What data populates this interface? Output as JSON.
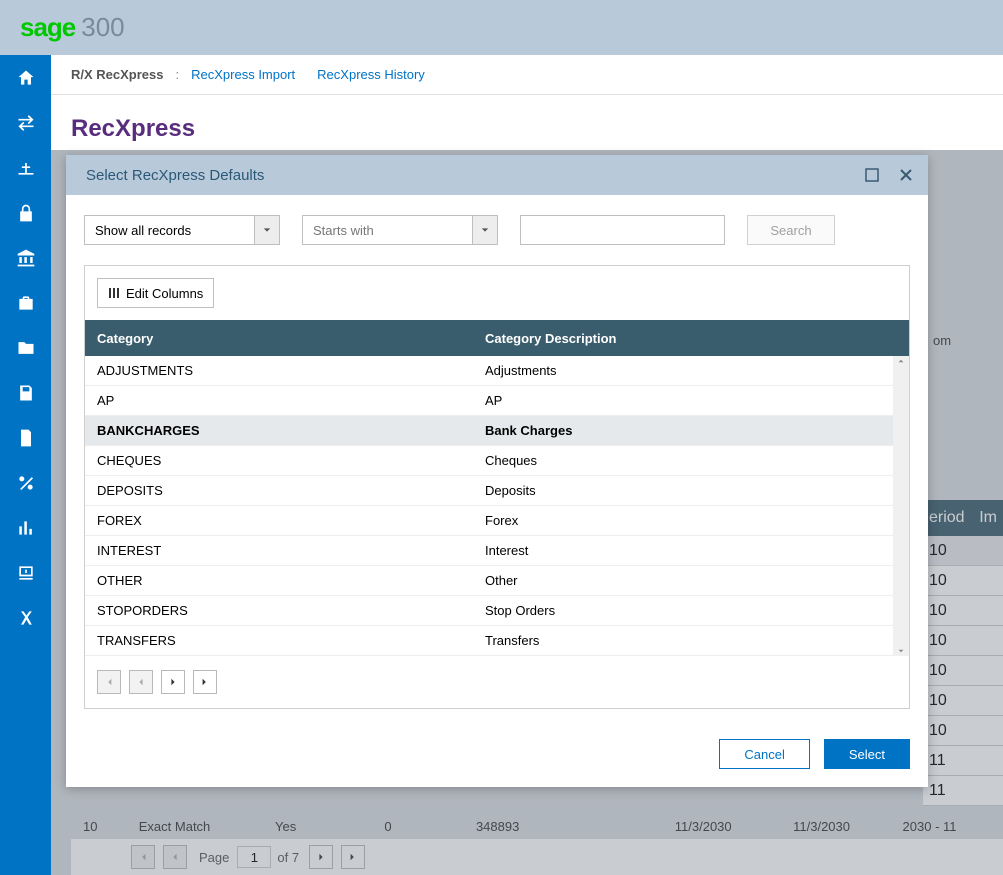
{
  "brand": {
    "sage": "sage",
    "suffix": "300"
  },
  "breadcrumb": {
    "root": "R/X RecXpress",
    "sep": ":",
    "links": [
      "RecXpress Import",
      "RecXpress History"
    ]
  },
  "page": {
    "title": "RecXpress"
  },
  "modal": {
    "title": "Select RecXpress Defaults",
    "filter_show_all": "Show all records",
    "filter_starts_with": "Starts with",
    "search_value": "",
    "search_btn": "Search",
    "edit_columns": "Edit Columns",
    "columns": {
      "category": "Category",
      "description": "Category Description"
    },
    "rows": [
      {
        "category": "ADJUSTMENTS",
        "description": "Adjustments",
        "selected": false
      },
      {
        "category": "AP",
        "description": "AP",
        "selected": false
      },
      {
        "category": "BANKCHARGES",
        "description": "Bank Charges",
        "selected": true
      },
      {
        "category": "CHEQUES",
        "description": "Cheques",
        "selected": false
      },
      {
        "category": "DEPOSITS",
        "description": "Deposits",
        "selected": false
      },
      {
        "category": "FOREX",
        "description": "Forex",
        "selected": false
      },
      {
        "category": "INTEREST",
        "description": "Interest",
        "selected": false
      },
      {
        "category": "OTHER",
        "description": "Other",
        "selected": false
      },
      {
        "category": "STOPORDERS",
        "description": "Stop Orders",
        "selected": false
      },
      {
        "category": "TRANSFERS",
        "description": "Transfers",
        "selected": false
      }
    ],
    "cancel": "Cancel",
    "select": "Select"
  },
  "background_columns": {
    "from": "om",
    "period": "eriod",
    "im": "Im"
  },
  "background_rows": [
    {
      "period": "10"
    },
    {
      "period": "10"
    },
    {
      "period": "10"
    },
    {
      "period": "10"
    },
    {
      "period": "10"
    },
    {
      "period": "10"
    },
    {
      "period": "10"
    },
    {
      "period": "11"
    },
    {
      "period": "11"
    }
  ],
  "bottom_visible_row": {
    "col1": "10",
    "col2": "Exact Match",
    "col3": "Yes",
    "col4": "0",
    "col5": "348893",
    "col6": "11/3/2030",
    "col7": "11/3/2030",
    "col8": "2030 - 11"
  },
  "footer_pager": {
    "page_label": "Page",
    "current": "1",
    "of_label": "of 7"
  }
}
